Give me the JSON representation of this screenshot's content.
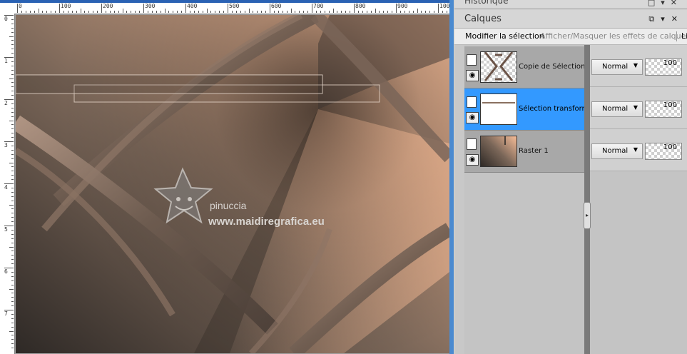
{
  "ruler": {
    "top_labels": [
      "0",
      "100",
      "200",
      "300",
      "400",
      "500",
      "600",
      "700",
      "800",
      "900",
      "1000"
    ],
    "left_labels": [
      "0",
      "1",
      "2",
      "3",
      "4",
      "5",
      "6",
      "7"
    ]
  },
  "watermark": {
    "line1": "pinuccia",
    "line2": "www.maidiregrafica.eu"
  },
  "panel": {
    "history_title": "Historique",
    "layers_title": "Calques",
    "toolbar": {
      "modify_selection": "Modifier la sélection",
      "toggle_effects": "Afficher/Masquer les effets de calque",
      "cut_item": "Li"
    },
    "layers": [
      {
        "name": "Copie de Sélection tra",
        "blend": "Normal",
        "opacity": "100",
        "selected": false
      },
      {
        "name": "Sélection transformée",
        "blend": "Normal",
        "opacity": "100",
        "selected": true
      },
      {
        "name": "Raster 1",
        "blend": "Normal",
        "opacity": "100",
        "selected": false
      }
    ]
  },
  "colors": {
    "selection_blue": "#3399ff",
    "ruler_accent": "#2a62b4",
    "canvas_dark": "#3e3632",
    "canvas_light": "#f5b994"
  }
}
